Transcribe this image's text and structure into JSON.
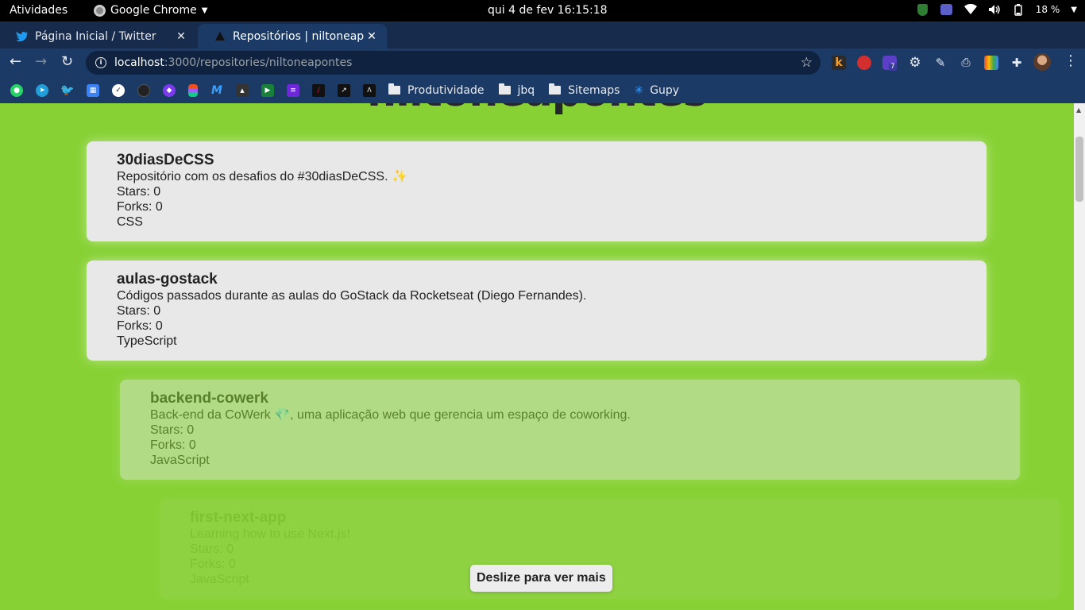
{
  "topbar": {
    "activities": "Atividades",
    "app_name": "Google Chrome",
    "clock": "qui 4 de fev  16:15:18",
    "battery": "18 %"
  },
  "tabs": [
    {
      "title": "Página Inicial / Twitter",
      "icon": "twitter-icon"
    },
    {
      "title": "Repositórios | niltoneapontes",
      "icon": "vercel-icon"
    }
  ],
  "omnibox": {
    "host": "localhost",
    "path": ":3000/repositories/niltoneapontes"
  },
  "extensions": {
    "badge_count": "7"
  },
  "bookmarks": {
    "folders": [
      "Produtividade",
      "jbq",
      "Sitemaps"
    ],
    "gupy": "Gupy"
  },
  "page": {
    "heading": "niltoneapontes",
    "repositories": [
      {
        "name": "30diasDeCSS",
        "description": "Repositório com os desafios do #30diasDeCSS.",
        "description_emoji": "✨",
        "stars": "Stars: 0",
        "forks": "Forks: 0",
        "language": "CSS"
      },
      {
        "name": "aulas-gostack",
        "description": "Códigos passados durante as aulas do GoStack da Rocketseat (Diego Fernandes).",
        "stars": "Stars: 0",
        "forks": "Forks: 0",
        "language": "TypeScript"
      },
      {
        "name": "backend-cowerk",
        "description_prefix": "Back-end da CoWerk ",
        "description_emoji": "💎",
        "description_suffix": ", uma aplicação web que gerencia um espaço de coworking.",
        "stars": "Stars: 0",
        "forks": "Forks: 0",
        "language": "JavaScript"
      },
      {
        "name": "first-next-app",
        "description": "Learning how to use Next.js!",
        "stars": "Stars: 0",
        "forks": "Forks: 0",
        "language": "JavaScript"
      }
    ],
    "scroll_hint": "Deslize para ver mais"
  },
  "colors": {
    "page_background": "#87d134",
    "card_background": "#e8e8e8",
    "chrome_frame": "#172b4d",
    "chrome_toolbar": "#1c3a66"
  }
}
